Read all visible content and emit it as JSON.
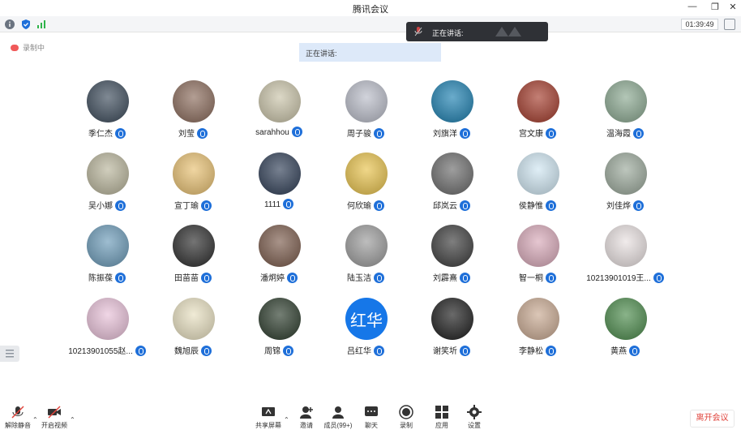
{
  "window": {
    "title": "腾讯会议",
    "controls": [
      "minimize",
      "maximize",
      "close"
    ]
  },
  "toolbar": {
    "timer": "01:39:49"
  },
  "status": {
    "recording": "录制中",
    "speaking_banner": "正在讲话:",
    "speaking_toast": "正在讲话:"
  },
  "participants": [
    {
      "name": "季仁杰",
      "bg": "#3b4a5a"
    },
    {
      "name": "刘莹",
      "bg": "#8a6a5a"
    },
    {
      "name": "sarahhou",
      "bg": "#c9c3a8"
    },
    {
      "name": "周子骏",
      "bg": "#b9bcc8"
    },
    {
      "name": "刘旗洋",
      "bg": "#1b7fb0"
    },
    {
      "name": "宫文康",
      "bg": "#a33a2a"
    },
    {
      "name": "温海霞",
      "bg": "#8aa890"
    },
    {
      "name": "吴小娜",
      "bg": "#b8b49a"
    },
    {
      "name": "宣丁瑜",
      "bg": "#e8c070"
    },
    {
      "name": "1111",
      "bg": "#2e3d55"
    },
    {
      "name": "何欣瑜",
      "bg": "#e8c24a"
    },
    {
      "name": "邱岚云",
      "bg": "#6a6a6a"
    },
    {
      "name": "侯静惟",
      "bg": "#cfe6f2"
    },
    {
      "name": "刘佳烨",
      "bg": "#9aa89a"
    },
    {
      "name": "陈振葆",
      "bg": "#6a9ab8"
    },
    {
      "name": "田苗苗",
      "bg": "#2a2a2a"
    },
    {
      "name": "潘炯婷",
      "bg": "#7a5a4a"
    },
    {
      "name": "陆玉洁",
      "bg": "#9a9a9a"
    },
    {
      "name": "刘霹熹",
      "bg": "#3a3a3a"
    },
    {
      "name": "智一桐",
      "bg": "#d8a8b8"
    },
    {
      "name": "10213901019王...",
      "bg": "#e8e0e0"
    },
    {
      "name": "10213901055赵...",
      "bg": "#e8c0d8"
    },
    {
      "name": "魏旭辰",
      "bg": "#e8e0c0"
    },
    {
      "name": "周锦",
      "bg": "#2a3a2a"
    },
    {
      "name": "吕红华",
      "bg": "#1677e8",
      "text": "红华"
    },
    {
      "name": "谢笑圻",
      "bg": "#1a1a1a"
    },
    {
      "name": "李静松",
      "bg": "#c8a890"
    },
    {
      "name": "黄燕",
      "bg": "#4a8a4a"
    }
  ],
  "bottombar": {
    "unmute": "解除静音",
    "video": "开启视频",
    "share": "共享屏幕",
    "invite": "邀请",
    "members": "成员(99+)",
    "chat": "聊天",
    "record": "录制",
    "apps": "应用",
    "settings": "设置",
    "leave": "离开会议"
  }
}
